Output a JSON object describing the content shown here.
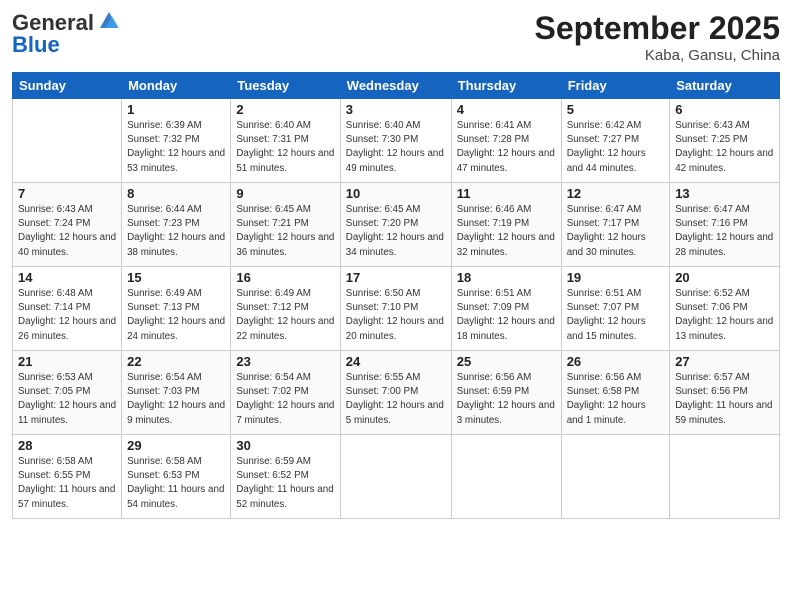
{
  "header": {
    "logo_line1": "General",
    "logo_line2": "Blue",
    "month": "September 2025",
    "location": "Kaba, Gansu, China"
  },
  "weekdays": [
    "Sunday",
    "Monday",
    "Tuesday",
    "Wednesday",
    "Thursday",
    "Friday",
    "Saturday"
  ],
  "weeks": [
    [
      {
        "day": "",
        "sunrise": "",
        "sunset": "",
        "daylight": ""
      },
      {
        "day": "1",
        "sunrise": "Sunrise: 6:39 AM",
        "sunset": "Sunset: 7:32 PM",
        "daylight": "Daylight: 12 hours and 53 minutes."
      },
      {
        "day": "2",
        "sunrise": "Sunrise: 6:40 AM",
        "sunset": "Sunset: 7:31 PM",
        "daylight": "Daylight: 12 hours and 51 minutes."
      },
      {
        "day": "3",
        "sunrise": "Sunrise: 6:40 AM",
        "sunset": "Sunset: 7:30 PM",
        "daylight": "Daylight: 12 hours and 49 minutes."
      },
      {
        "day": "4",
        "sunrise": "Sunrise: 6:41 AM",
        "sunset": "Sunset: 7:28 PM",
        "daylight": "Daylight: 12 hours and 47 minutes."
      },
      {
        "day": "5",
        "sunrise": "Sunrise: 6:42 AM",
        "sunset": "Sunset: 7:27 PM",
        "daylight": "Daylight: 12 hours and 44 minutes."
      },
      {
        "day": "6",
        "sunrise": "Sunrise: 6:43 AM",
        "sunset": "Sunset: 7:25 PM",
        "daylight": "Daylight: 12 hours and 42 minutes."
      }
    ],
    [
      {
        "day": "7",
        "sunrise": "Sunrise: 6:43 AM",
        "sunset": "Sunset: 7:24 PM",
        "daylight": "Daylight: 12 hours and 40 minutes."
      },
      {
        "day": "8",
        "sunrise": "Sunrise: 6:44 AM",
        "sunset": "Sunset: 7:23 PM",
        "daylight": "Daylight: 12 hours and 38 minutes."
      },
      {
        "day": "9",
        "sunrise": "Sunrise: 6:45 AM",
        "sunset": "Sunset: 7:21 PM",
        "daylight": "Daylight: 12 hours and 36 minutes."
      },
      {
        "day": "10",
        "sunrise": "Sunrise: 6:45 AM",
        "sunset": "Sunset: 7:20 PM",
        "daylight": "Daylight: 12 hours and 34 minutes."
      },
      {
        "day": "11",
        "sunrise": "Sunrise: 6:46 AM",
        "sunset": "Sunset: 7:19 PM",
        "daylight": "Daylight: 12 hours and 32 minutes."
      },
      {
        "day": "12",
        "sunrise": "Sunrise: 6:47 AM",
        "sunset": "Sunset: 7:17 PM",
        "daylight": "Daylight: 12 hours and 30 minutes."
      },
      {
        "day": "13",
        "sunrise": "Sunrise: 6:47 AM",
        "sunset": "Sunset: 7:16 PM",
        "daylight": "Daylight: 12 hours and 28 minutes."
      }
    ],
    [
      {
        "day": "14",
        "sunrise": "Sunrise: 6:48 AM",
        "sunset": "Sunset: 7:14 PM",
        "daylight": "Daylight: 12 hours and 26 minutes."
      },
      {
        "day": "15",
        "sunrise": "Sunrise: 6:49 AM",
        "sunset": "Sunset: 7:13 PM",
        "daylight": "Daylight: 12 hours and 24 minutes."
      },
      {
        "day": "16",
        "sunrise": "Sunrise: 6:49 AM",
        "sunset": "Sunset: 7:12 PM",
        "daylight": "Daylight: 12 hours and 22 minutes."
      },
      {
        "day": "17",
        "sunrise": "Sunrise: 6:50 AM",
        "sunset": "Sunset: 7:10 PM",
        "daylight": "Daylight: 12 hours and 20 minutes."
      },
      {
        "day": "18",
        "sunrise": "Sunrise: 6:51 AM",
        "sunset": "Sunset: 7:09 PM",
        "daylight": "Daylight: 12 hours and 18 minutes."
      },
      {
        "day": "19",
        "sunrise": "Sunrise: 6:51 AM",
        "sunset": "Sunset: 7:07 PM",
        "daylight": "Daylight: 12 hours and 15 minutes."
      },
      {
        "day": "20",
        "sunrise": "Sunrise: 6:52 AM",
        "sunset": "Sunset: 7:06 PM",
        "daylight": "Daylight: 12 hours and 13 minutes."
      }
    ],
    [
      {
        "day": "21",
        "sunrise": "Sunrise: 6:53 AM",
        "sunset": "Sunset: 7:05 PM",
        "daylight": "Daylight: 12 hours and 11 minutes."
      },
      {
        "day": "22",
        "sunrise": "Sunrise: 6:54 AM",
        "sunset": "Sunset: 7:03 PM",
        "daylight": "Daylight: 12 hours and 9 minutes."
      },
      {
        "day": "23",
        "sunrise": "Sunrise: 6:54 AM",
        "sunset": "Sunset: 7:02 PM",
        "daylight": "Daylight: 12 hours and 7 minutes."
      },
      {
        "day": "24",
        "sunrise": "Sunrise: 6:55 AM",
        "sunset": "Sunset: 7:00 PM",
        "daylight": "Daylight: 12 hours and 5 minutes."
      },
      {
        "day": "25",
        "sunrise": "Sunrise: 6:56 AM",
        "sunset": "Sunset: 6:59 PM",
        "daylight": "Daylight: 12 hours and 3 minutes."
      },
      {
        "day": "26",
        "sunrise": "Sunrise: 6:56 AM",
        "sunset": "Sunset: 6:58 PM",
        "daylight": "Daylight: 12 hours and 1 minute."
      },
      {
        "day": "27",
        "sunrise": "Sunrise: 6:57 AM",
        "sunset": "Sunset: 6:56 PM",
        "daylight": "Daylight: 11 hours and 59 minutes."
      }
    ],
    [
      {
        "day": "28",
        "sunrise": "Sunrise: 6:58 AM",
        "sunset": "Sunset: 6:55 PM",
        "daylight": "Daylight: 11 hours and 57 minutes."
      },
      {
        "day": "29",
        "sunrise": "Sunrise: 6:58 AM",
        "sunset": "Sunset: 6:53 PM",
        "daylight": "Daylight: 11 hours and 54 minutes."
      },
      {
        "day": "30",
        "sunrise": "Sunrise: 6:59 AM",
        "sunset": "Sunset: 6:52 PM",
        "daylight": "Daylight: 11 hours and 52 minutes."
      },
      {
        "day": "",
        "sunrise": "",
        "sunset": "",
        "daylight": ""
      },
      {
        "day": "",
        "sunrise": "",
        "sunset": "",
        "daylight": ""
      },
      {
        "day": "",
        "sunrise": "",
        "sunset": "",
        "daylight": ""
      },
      {
        "day": "",
        "sunrise": "",
        "sunset": "",
        "daylight": ""
      }
    ]
  ]
}
